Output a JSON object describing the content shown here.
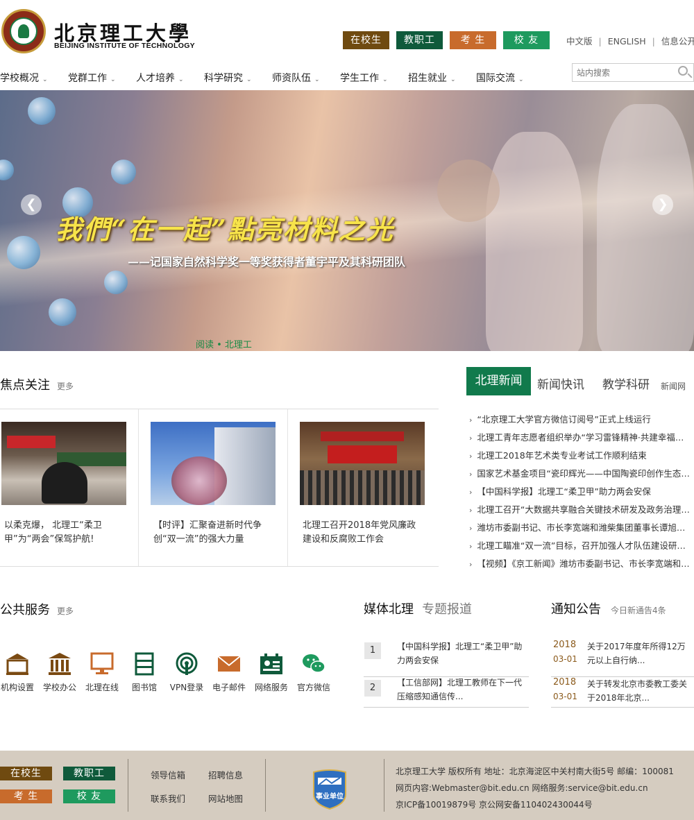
{
  "header": {
    "logo_cn": "北京理工大學",
    "logo_en": "BEIJING INSTITUTE OF TECHNOLOGY",
    "role_buttons": [
      {
        "label": "在校生",
        "color": "#6f4a10"
      },
      {
        "label": "教职工",
        "color": "#0f5a3b"
      },
      {
        "label": "考 生",
        "color": "#c86b2c"
      },
      {
        "label": "校 友",
        "color": "#1e9a5e"
      }
    ],
    "top_links": [
      "中文版",
      "ENGLISH",
      "信息公开"
    ],
    "search_placeholder": "站内搜索"
  },
  "nav": [
    "学校概况",
    "党群工作",
    "人才培养",
    "科学研究",
    "师资队伍",
    "学生工作",
    "招生就业",
    "国际交流"
  ],
  "banner": {
    "title": "我們“在一起”點亮材料之光",
    "subtitle": "——记国家自然科学奖一等奖获得者董宇平及其科研团队",
    "read_link": "阅读 • 北理工",
    "prev": "❮",
    "next": "❯"
  },
  "focus": {
    "title": "焦点关注",
    "more": "更多",
    "cards": [
      {
        "caption": "以柔克爆， 北理工“柔卫甲”为“两会”保驾护航!"
      },
      {
        "caption": "【时评】汇聚奋进新时代争创“双一流”的强大力量"
      },
      {
        "caption": "北理工召开2018年党风廉政建设和反腐败工作会"
      }
    ]
  },
  "news": {
    "tabs": [
      "北理新闻",
      "新闻快讯",
      "教学科研"
    ],
    "site_link": "新闻网",
    "items": [
      "“北京理工大学官方微信订阅号”正式上线运行",
      "北理工青年志愿者组织举办“学习雷锋精神·共建幸福社区”志愿服务活动",
      "北理工2018年艺术类专业考试工作顺利结束",
      "国家艺术基金项目“瓷印辉光——中国陶瓷印创作生态展”开幕",
      "【中国科学报】北理工“柔卫甲”助力两会安保",
      "北理工召开“大数据共享融合关键技术研发及政务治理应用示范”项目启动会",
      "潍坊市委副书记、市长李宽端和潍柴集团董事长谭旭光一行来访",
      "北理工瞄准“双一流”目标，召开加强人才队伍建设研讨会",
      "【视频】《京工新闻》潍坊市委副书记、市长李宽端和潍柴集团董事长来访"
    ]
  },
  "services": {
    "title": "公共服务",
    "more": "更多",
    "items": [
      {
        "label": "机构设置",
        "icon": "building-icon",
        "color": "#7a4a12"
      },
      {
        "label": "学校办公",
        "icon": "columns-icon",
        "color": "#7a4a12"
      },
      {
        "label": "北理在线",
        "icon": "monitor-icon",
        "color": "#c86b2c"
      },
      {
        "label": "图书馆",
        "icon": "bookshelf-icon",
        "color": "#0f5a3b"
      },
      {
        "label": "VPN登录",
        "icon": "wifi-icon",
        "color": "#0f5a3b"
      },
      {
        "label": "电子邮件",
        "icon": "mail-icon",
        "color": "#c86b2c"
      },
      {
        "label": "网络服务",
        "icon": "network-icon",
        "color": "#0f5a3b"
      },
      {
        "label": "官方微信",
        "icon": "wechat-icon",
        "color": "#1e9a5e"
      }
    ]
  },
  "media": {
    "title": "媒体北理",
    "tab2": "专题报道",
    "items": [
      {
        "num": "1",
        "text": "【中国科学报】北理工“柔卫甲”助力两会安保"
      },
      {
        "num": "2",
        "text": "【工信部网】北理工教师在下一代压缩感知通信传..."
      }
    ]
  },
  "notice": {
    "title": "通知公告",
    "today": "今日新通告4条",
    "items": [
      {
        "year": "2018",
        "date": "03-01",
        "text": "关于2017年度年所得12万元以上自行纳..."
      },
      {
        "year": "2018",
        "date": "03-01",
        "text": "关于转发北京市委教工委关于2018年北京..."
      }
    ]
  },
  "footer": {
    "buttons": [
      {
        "label": "在校生",
        "color": "#6f4a10"
      },
      {
        "label": "教职工",
        "color": "#0f5a3b"
      },
      {
        "label": "考 生",
        "color": "#c86b2c"
      },
      {
        "label": "校 友",
        "color": "#1e9a5e"
      }
    ],
    "links": [
      "领导信箱",
      "招聘信息",
      "联系我们",
      "网站地图"
    ],
    "badge": "事业单位",
    "info": [
      "北京理工大学 版权所有 地址：北京海淀区中关村南大街5号 邮编：100081",
      "网页内容:Webmaster@bit.edu.cn 网络服务:service@bit.edu.cn",
      "京ICP备10019879号 京公网安备110402430044号"
    ]
  }
}
